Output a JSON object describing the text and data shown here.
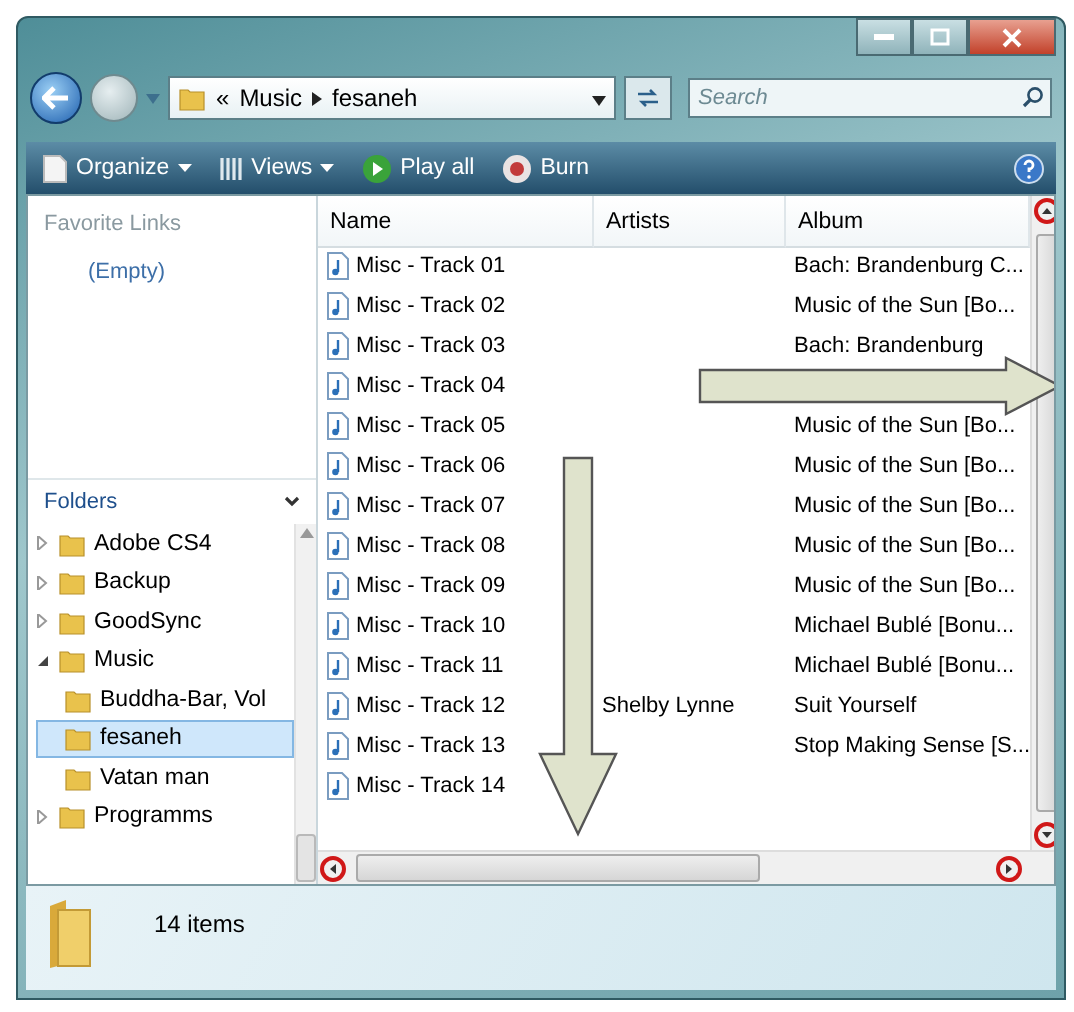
{
  "address": {
    "overflow": "«",
    "path": [
      "Music",
      "fesaneh"
    ]
  },
  "search": {
    "placeholder": "Search"
  },
  "toolbar": [
    {
      "label": "Organize",
      "kind": "organize"
    },
    {
      "label": "Views",
      "kind": "views"
    },
    {
      "label": "Play all",
      "kind": "play"
    },
    {
      "label": "Burn",
      "kind": "burn"
    }
  ],
  "favorite_links": {
    "title": "Favorite Links",
    "empty": "(Empty)"
  },
  "folders": {
    "title": "Folders",
    "items": [
      {
        "name": "Adobe CS4",
        "expanded": false,
        "selected": false
      },
      {
        "name": "Backup",
        "expanded": false,
        "selected": false
      },
      {
        "name": "GoodSync",
        "expanded": false,
        "selected": false
      },
      {
        "name": "Music",
        "expanded": true,
        "selected": false,
        "children": [
          {
            "name": "Buddha-Bar, Vol",
            "selected": false
          },
          {
            "name": "fesaneh",
            "selected": true
          },
          {
            "name": "Vatan man",
            "selected": false
          }
        ]
      },
      {
        "name": "Programms",
        "expanded": false,
        "selected": false
      }
    ]
  },
  "table": {
    "columns": [
      "Name",
      "Artists",
      "Album"
    ],
    "rows": [
      {
        "name": "Misc - Track 01",
        "album": "Bach: Brandenburg C..."
      },
      {
        "name": "Misc - Track 02",
        "album": "Music of the Sun [Bo..."
      },
      {
        "name": "Misc - Track 03",
        "album": "Bach: Brandenburg"
      },
      {
        "name": "Misc - Track 04"
      },
      {
        "name": "Misc - Track 05",
        "album": "Music of the Sun [Bo..."
      },
      {
        "name": "Misc - Track 06",
        "album": "Music of the Sun [Bo..."
      },
      {
        "name": "Misc - Track 07",
        "album": "Music of the Sun [Bo..."
      },
      {
        "name": "Misc - Track 08",
        "album": "Music of the Sun [Bo..."
      },
      {
        "name": "Misc - Track 09",
        "album": "Music of the Sun [Bo..."
      },
      {
        "name": "Misc - Track 10",
        "album": "Michael Bublé [Bonu..."
      },
      {
        "name": "Misc - Track 11",
        "album": "Michael Bublé [Bonu..."
      },
      {
        "name": "Misc - Track 12",
        "artists": "Shelby Lynne",
        "album": "Suit Yourself"
      },
      {
        "name": "Misc - Track 13",
        "album": "Stop Making Sense [S..."
      },
      {
        "name": "Misc - Track 14"
      }
    ]
  },
  "scrollbars": {
    "up_highlighted": true,
    "down_highlighted": true,
    "left_highlighted": true,
    "right_highlighted": true
  },
  "annotations": [
    {
      "kind": "right-arrow"
    },
    {
      "kind": "down-arrow"
    }
  ],
  "status_bar": {
    "text": "14 items"
  }
}
